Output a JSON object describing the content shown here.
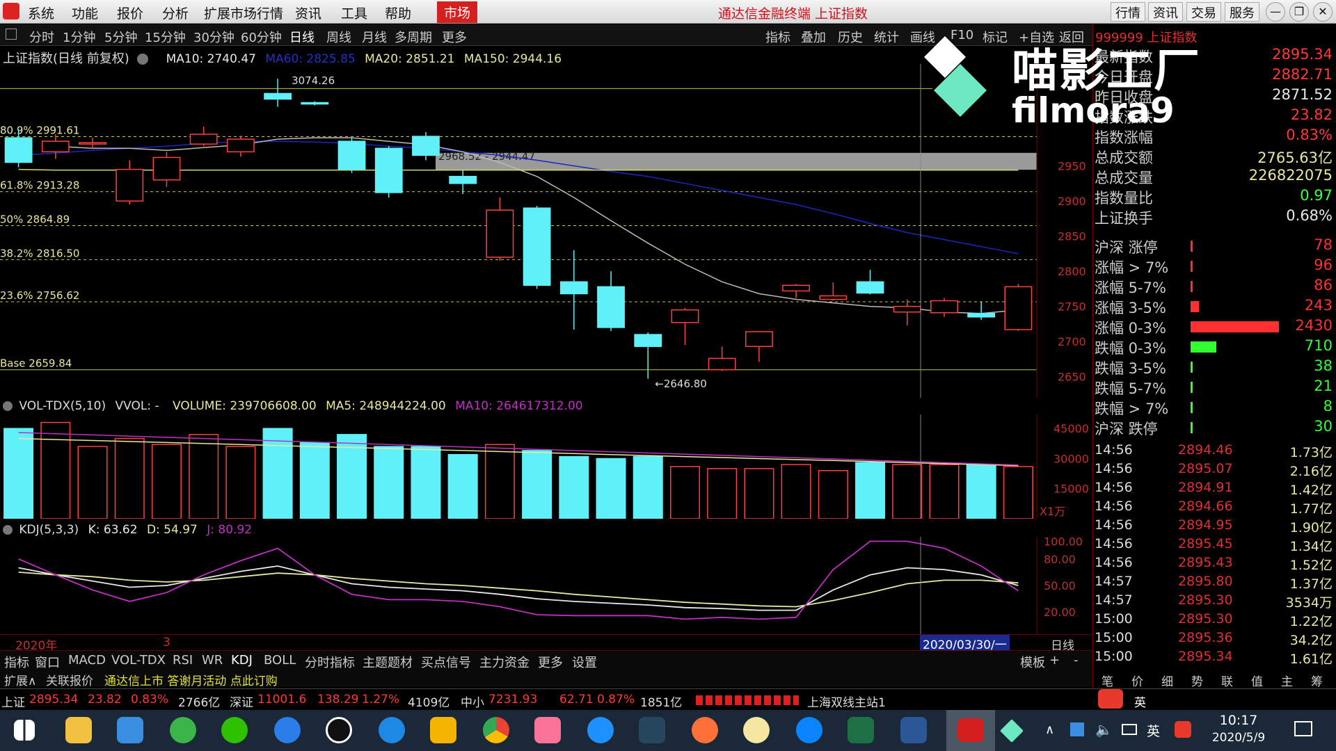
{
  "menubar": {
    "items": [
      "系统",
      "功能",
      "报价",
      "分析",
      "扩展市场行情",
      "资讯",
      "工具",
      "帮助"
    ],
    "active": "市场",
    "title": "通达信金融终端 上证指数",
    "right": [
      "行情",
      "资讯",
      "交易",
      "服务"
    ]
  },
  "toolbar": {
    "periods": [
      "分时",
      "1分钟",
      "5分钟",
      "15分钟",
      "30分钟",
      "60分钟",
      "日线",
      "周线",
      "月线",
      "多周期",
      "更多"
    ],
    "selected": "日线",
    "right": [
      "指标",
      "叠加",
      "历史",
      "统计",
      "画线",
      "F10",
      "标记",
      "+自选",
      "返回"
    ]
  },
  "chart": {
    "name": "上证指数(日线 前复权)",
    "ma": {
      "ma10": "MA10: 2740.47",
      "ma60": "MA60: 2825.85",
      "ma20": "MA20: 2851.21",
      "ma150": "MA150: 2944.16"
    },
    "fib": [
      "80.9% 2991.61",
      "61.8% 2913.28",
      "50% 2864.89",
      "38.2% 2816.50",
      "23.6% 2756.62",
      "Base 2659.84"
    ],
    "high_label": "3074.26",
    "gap_label": "2968.52 - 2944.47",
    "low_label": "2646.80",
    "yticks": [
      "2950",
      "2900",
      "2850",
      "2800",
      "2750",
      "2700",
      "2650"
    ]
  },
  "volume": {
    "title": "VOL-TDX(5,10)",
    "vvol": "VVOL: -",
    "volume": "VOLUME: 239706608.00",
    "ma5": "MA5: 248944224.00",
    "ma10": "MA10: 264617312.00",
    "yticks": [
      "45000",
      "30000",
      "15000"
    ],
    "unit": "X1万"
  },
  "kdj": {
    "title": "KDJ(5,3,3)",
    "k": "K: 63.62",
    "d": "D: 54.97",
    "j": "J: 80.92",
    "yticks": [
      "100.00",
      "80.00",
      "50.00",
      "20.00"
    ]
  },
  "axis": {
    "year": "2020年",
    "month": "3",
    "cursor_date": "2020/03/30/一",
    "period": "日线"
  },
  "tabs": [
    "指标",
    "窗口",
    "MACD",
    "VOL-TDX",
    "RSI",
    "WR",
    "KDJ",
    "BOLL",
    "分时指标",
    "主题题材",
    "买点信号",
    "主力资金",
    "更多",
    "设置"
  ],
  "tabs_active": "KDJ",
  "tabs_right": [
    "模板",
    "+",
    "-"
  ],
  "subbar": {
    "expand": "扩展∧",
    "related": "关联报价",
    "ad": "通达信上市 答谢月活动 点此订购"
  },
  "right_panel": {
    "header": "999999 上证指数",
    "quotes": [
      {
        "label": "最新指数",
        "value": "2895.34",
        "color": "#ff3838"
      },
      {
        "label": "今日开盘",
        "value": "2882.71",
        "color": "#ff3838"
      },
      {
        "label": "昨日收盘",
        "value": "2871.52",
        "color": "#e8e8e8"
      },
      {
        "label": "指数涨跌",
        "value": "23.82",
        "color": "#ff3838"
      },
      {
        "label": "指数涨幅",
        "value": "0.83%",
        "color": "#ff3838"
      },
      {
        "label": "总成交额",
        "value": "2765.63亿",
        "color": "#e8e8a0"
      },
      {
        "label": "总成交量",
        "value": "226822075",
        "color": "#e8e8a0"
      },
      {
        "label": "指数量比",
        "value": "0.97",
        "color": "#40ff40"
      },
      {
        "label": "上证换手",
        "value": "0.68%",
        "color": "#e8e8e8"
      }
    ],
    "breadth": [
      {
        "label": "沪深 涨停",
        "value": "78",
        "bar": 0.01,
        "color": "#ff3030"
      },
      {
        "label": "涨幅 > 7%",
        "value": "96",
        "bar": 0.01,
        "color": "#ff3030"
      },
      {
        "label": "涨幅 5-7%",
        "value": "86",
        "bar": 0.01,
        "color": "#ff3030"
      },
      {
        "label": "涨幅 3-5%",
        "value": "243",
        "bar": 0.05,
        "color": "#ff3030"
      },
      {
        "label": "涨幅 0-3%",
        "value": "2430",
        "bar": 0.55,
        "color": "#ff3030"
      },
      {
        "label": "跌幅 0-3%",
        "value": "710",
        "bar": 0.16,
        "color": "#30ff30"
      },
      {
        "label": "跌幅 3-5%",
        "value": "38",
        "bar": 0.005,
        "color": "#30ff30"
      },
      {
        "label": "跌幅 5-7%",
        "value": "21",
        "bar": 0.005,
        "color": "#30ff30"
      },
      {
        "label": "跌幅 > 7%",
        "value": "8",
        "bar": 0.005,
        "color": "#30ff30"
      },
      {
        "label": "沪深 跌停",
        "value": "30",
        "bar": 0.005,
        "color": "#30ff30"
      }
    ],
    "ticks": [
      {
        "time": "14:56",
        "price": "2894.46",
        "amount": "1.73亿"
      },
      {
        "time": "14:56",
        "price": "2895.07",
        "amount": "2.16亿"
      },
      {
        "time": "14:56",
        "price": "2894.91",
        "amount": "1.42亿"
      },
      {
        "time": "14:56",
        "price": "2894.66",
        "amount": "1.77亿"
      },
      {
        "time": "14:56",
        "price": "2894.95",
        "amount": "1.90亿"
      },
      {
        "time": "14:56",
        "price": "2895.45",
        "amount": "1.34亿"
      },
      {
        "time": "14:56",
        "price": "2895.43",
        "amount": "1.52亿"
      },
      {
        "time": "14:57",
        "price": "2895.80",
        "amount": "1.37亿"
      },
      {
        "time": "14:57",
        "price": "2895.30",
        "amount": "3534万"
      },
      {
        "time": "15:00",
        "price": "2895.30",
        "amount": "1.22亿"
      },
      {
        "time": "15:00",
        "price": "2895.36",
        "amount": "34.2亿"
      },
      {
        "time": "15:00",
        "price": "2895.34",
        "amount": "1.61亿"
      }
    ],
    "bottom_tabs": [
      "笔",
      "价",
      "细",
      "势",
      "联",
      "值",
      "主",
      "筹"
    ]
  },
  "statusbar": {
    "sh_label": "上证",
    "sh_price": "2895.34",
    "sh_chg": "23.82",
    "sh_pct": "0.83%",
    "sh_amt": "2766亿",
    "sz_label": "深证",
    "sz_price": "11001.6",
    "sz_chg": "138.29",
    "sz_pct": "1.27%",
    "sz_amt": "4109亿",
    "zx_label": "中小",
    "zx_price": "7231.93",
    "zx_chg": "62.71",
    "zx_pct": "0.87%",
    "zx_amt": "1851亿",
    "server": "上海双线主站1"
  },
  "watermark": {
    "text": "喵影工厂",
    "brand": "filmora9"
  },
  "taskbar": {
    "time": "10:17",
    "date": "2020/5/9",
    "ime": "英"
  },
  "candles": [
    {
      "o": 2990,
      "c": 2955,
      "h": 3002,
      "l": 2948
    },
    {
      "o": 2970,
      "c": 2985,
      "h": 2995,
      "l": 2960
    },
    {
      "o": 2982,
      "c": 2983,
      "h": 2990,
      "l": 2975
    },
    {
      "o": 2900,
      "c": 2945,
      "h": 2958,
      "l": 2895
    },
    {
      "o": 2930,
      "c": 2962,
      "h": 2970,
      "l": 2920
    },
    {
      "o": 2981,
      "c": 2995,
      "h": 3006,
      "l": 2978
    },
    {
      "o": 2970,
      "c": 2988,
      "h": 2993,
      "l": 2963
    },
    {
      "o": 3053,
      "c": 3045,
      "h": 3074,
      "l": 3034
    },
    {
      "o": 3040,
      "c": 3038,
      "h": 3042,
      "l": 3036
    },
    {
      "o": 2985,
      "c": 2945,
      "h": 2990,
      "l": 2940
    },
    {
      "o": 2975,
      "c": 2912,
      "h": 2978,
      "l": 2905
    },
    {
      "o": 2992,
      "c": 2965,
      "h": 2998,
      "l": 2958
    },
    {
      "o": 2935,
      "c": 2925,
      "h": 2945,
      "l": 2910
    },
    {
      "o": 2820,
      "c": 2887,
      "h": 2905,
      "l": 2815
    },
    {
      "o": 2890,
      "c": 2780,
      "h": 2893,
      "l": 2775
    },
    {
      "o": 2785,
      "c": 2768,
      "h": 2830,
      "l": 2717
    },
    {
      "o": 2778,
      "c": 2720,
      "h": 2800,
      "l": 2715
    },
    {
      "o": 2710,
      "c": 2693,
      "h": 2713,
      "l": 2647
    },
    {
      "o": 2727,
      "c": 2745,
      "h": 2748,
      "l": 2695
    },
    {
      "o": 2660,
      "c": 2676,
      "h": 2693,
      "l": 2658
    },
    {
      "o": 2693,
      "c": 2714,
      "h": 2714,
      "l": 2671
    },
    {
      "o": 2772,
      "c": 2780,
      "h": 2782,
      "l": 2762
    },
    {
      "o": 2760,
      "c": 2765,
      "h": 2784,
      "l": 2758
    },
    {
      "o": 2785,
      "c": 2769,
      "h": 2802,
      "l": 2767
    },
    {
      "o": 2742,
      "c": 2750,
      "h": 2760,
      "l": 2723
    },
    {
      "o": 2741,
      "c": 2758,
      "h": 2762,
      "l": 2735
    },
    {
      "o": 2740,
      "c": 2735,
      "h": 2757,
      "l": 2731
    },
    {
      "o": 2717,
      "c": 2778,
      "h": 2782,
      "l": 2715
    }
  ]
}
